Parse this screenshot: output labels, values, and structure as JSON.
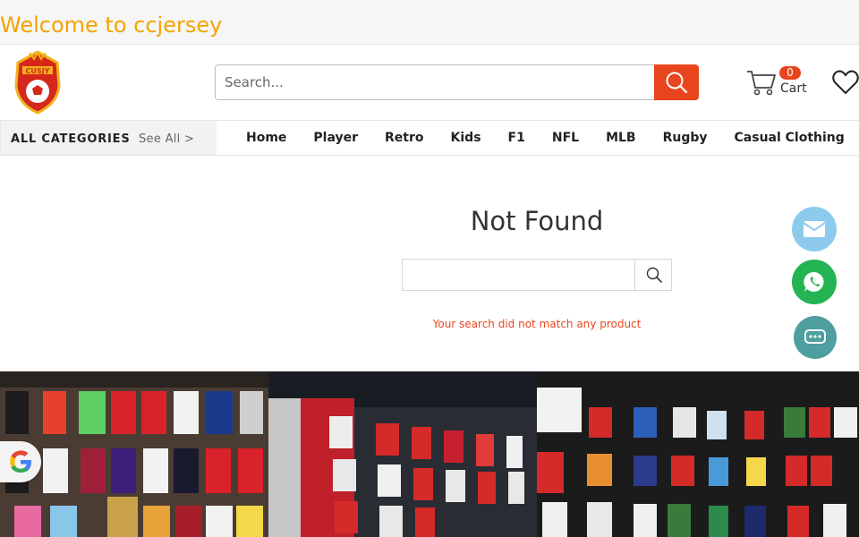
{
  "topbar": {
    "welcome": "Welcome to ccjersey"
  },
  "header": {
    "logo_text": "CUSJY",
    "search_placeholder": "Search...",
    "cart_count": "0",
    "cart_label": "Cart"
  },
  "nav": {
    "all_categories": "ALL CATEGORIES",
    "see_all": "See All >",
    "items": [
      "Home",
      "Player",
      "Retro",
      "Kids",
      "F1",
      "NFL",
      "MLB",
      "Rugby",
      "Casual Clothing"
    ]
  },
  "main": {
    "title": "Not Found",
    "message": "Your search did not match any product"
  },
  "colors": {
    "accent": "#e8451f",
    "welcome": "#f5a300",
    "email_btn": "#8ccbec",
    "whatsapp_btn": "#25b454",
    "chat_btn": "#4f9ea0"
  },
  "floating": [
    "email-icon",
    "whatsapp-icon",
    "chat-icon"
  ],
  "gallery": [
    "jersey-store-photo-1",
    "jersey-store-photo-2",
    "jersey-store-photo-3"
  ]
}
